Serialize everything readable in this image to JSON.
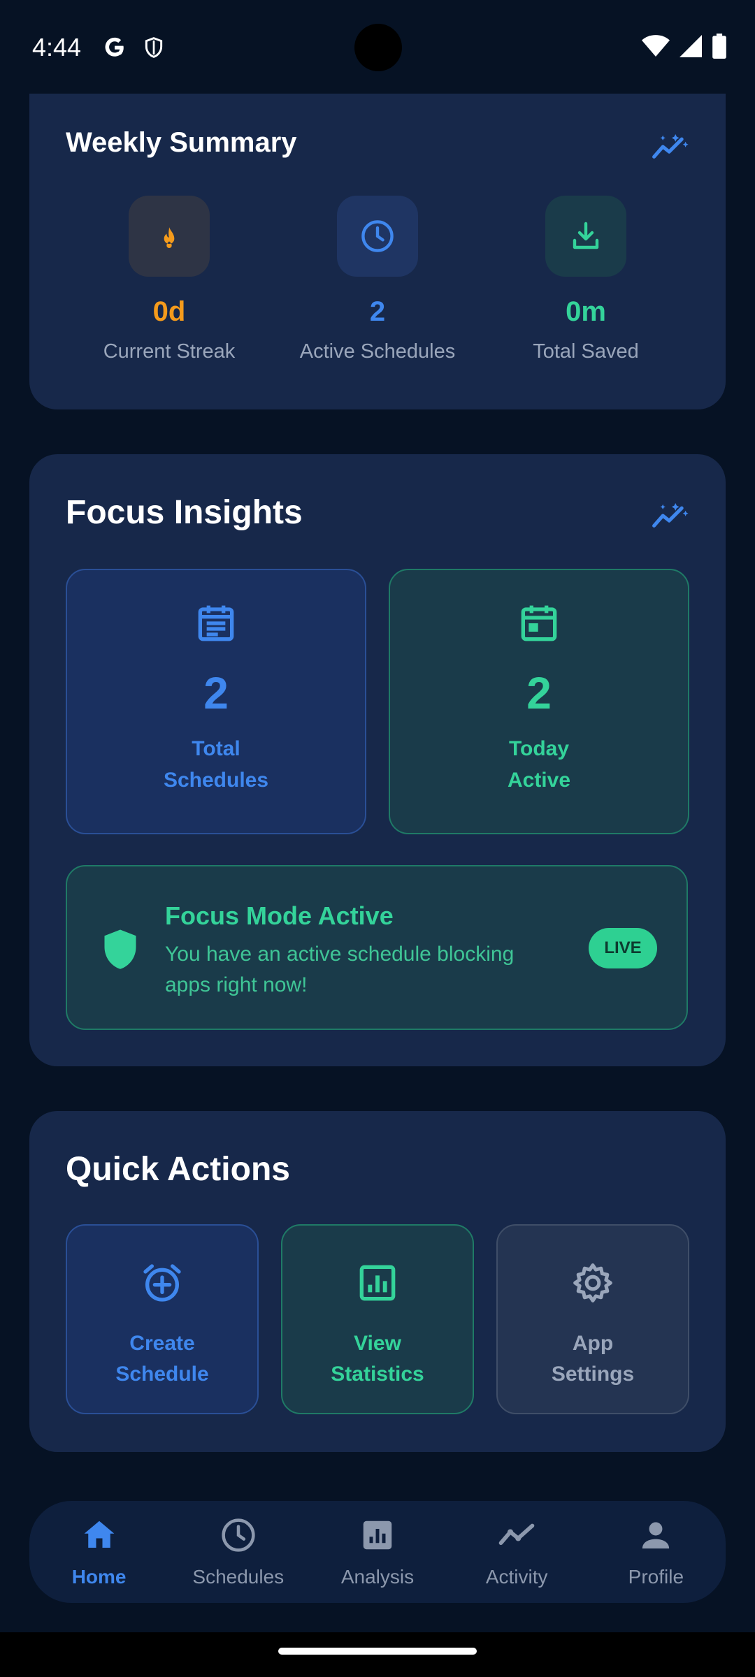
{
  "status_bar": {
    "time": "4:44",
    "icons": [
      "google-icon",
      "shield-icon",
      "wifi-icon",
      "signal-icon",
      "battery-icon"
    ]
  },
  "weekly_summary": {
    "title": "Weekly Summary",
    "stats": [
      {
        "value": "0d",
        "label": "Current Streak",
        "icon": "flame-icon",
        "color": "#f59b1c"
      },
      {
        "value": "2",
        "label": "Active Schedules",
        "icon": "clock-icon",
        "color": "#3f87ee"
      },
      {
        "value": "0m",
        "label": "Total Saved",
        "icon": "download-icon",
        "color": "#34d39a"
      }
    ]
  },
  "focus_insights": {
    "title": "Focus Insights",
    "boxes": [
      {
        "value": "2",
        "label": "Total\nSchedules",
        "icon": "calendar-list-icon"
      },
      {
        "value": "2",
        "label": "Today\nActive",
        "icon": "calendar-icon"
      }
    ],
    "live": {
      "title": "Focus Mode Active",
      "description": "You have an active schedule blocking apps right now!",
      "badge": "LIVE"
    }
  },
  "quick_actions": {
    "title": "Quick Actions",
    "actions": [
      {
        "label": "Create\nSchedule",
        "icon": "alarm-add-icon"
      },
      {
        "label": "View\nStatistics",
        "icon": "statistics-icon"
      },
      {
        "label": "App\nSettings",
        "icon": "gear-icon"
      }
    ]
  },
  "bottom_nav": {
    "items": [
      {
        "label": "Home",
        "icon": "home-icon",
        "active": true
      },
      {
        "label": "Schedules",
        "icon": "clock-icon",
        "active": false
      },
      {
        "label": "Analysis",
        "icon": "bar-chart-icon",
        "active": false
      },
      {
        "label": "Activity",
        "icon": "activity-icon",
        "active": false
      },
      {
        "label": "Profile",
        "icon": "person-icon",
        "active": false
      }
    ]
  },
  "colors": {
    "background": "#061224",
    "card": "#17284a",
    "blue": "#3f87ee",
    "green": "#34d39a",
    "orange": "#f59b1c",
    "gray": "#9aa6bb"
  }
}
